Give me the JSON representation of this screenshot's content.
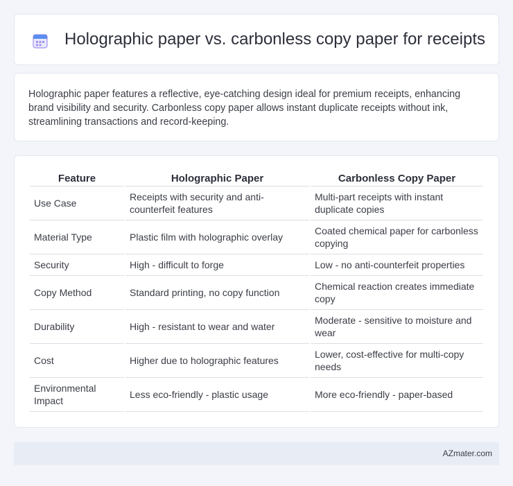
{
  "header": {
    "title": "Holographic paper vs. carbonless copy paper for receipts",
    "icon": "calendar-icon"
  },
  "summary": {
    "text": "Holographic paper features a reflective, eye-catching design ideal for premium receipts, enhancing brand visibility and security. Carbonless copy paper allows instant duplicate receipts without ink, streamlining transactions and record-keeping."
  },
  "table": {
    "headers": [
      "Feature",
      "Holographic Paper",
      "Carbonless Copy Paper"
    ],
    "rows": [
      [
        "Use Case",
        "Receipts with security and anti-counterfeit features",
        "Multi-part receipts with instant duplicate copies"
      ],
      [
        "Material Type",
        "Plastic film with holographic overlay",
        "Coated chemical paper for carbonless copying"
      ],
      [
        "Security",
        "High - difficult to forge",
        "Low - no anti-counterfeit properties"
      ],
      [
        "Copy Method",
        "Standard printing, no copy function",
        "Chemical reaction creates immediate copy"
      ],
      [
        "Durability",
        "High - resistant to wear and water",
        "Moderate - sensitive to moisture and wear"
      ],
      [
        "Cost",
        "Higher due to holographic features",
        "Lower, cost-effective for multi-copy needs"
      ],
      [
        "Environmental Impact",
        "Less eco-friendly - plastic usage",
        "More eco-friendly - paper-based"
      ]
    ]
  },
  "footer": {
    "brand": "AZmater.com"
  },
  "colors": {
    "background": "#f3f5fa",
    "card": "#ffffff",
    "footer": "#e8ecf5",
    "icon_blue": "#5b8def",
    "icon_purple": "#a88ff0"
  }
}
